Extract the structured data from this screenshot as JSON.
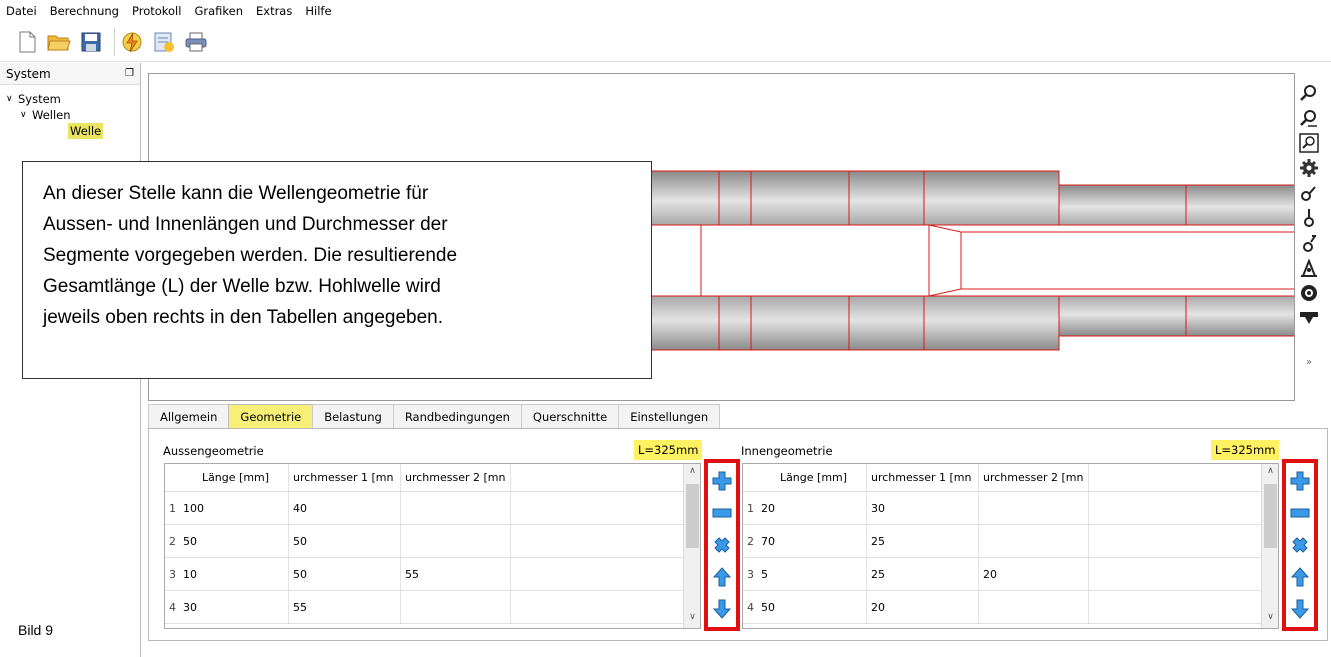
{
  "menu": [
    "Datei",
    "Berechnung",
    "Protokoll",
    "Grafiken",
    "Extras",
    "Hilfe"
  ],
  "system_panel": {
    "title": "System",
    "tree": {
      "root": "System",
      "group": "Wellen",
      "item": "Welle"
    }
  },
  "tooltip": {
    "lines": [
      "An dieser Stelle kann die Wellengeometrie für",
      "Aussen- und Innenlängen und Durchmesser der",
      "Segmente vorgegeben werden. Die resultierende",
      "Gesamtlänge (L) der Welle bzw. Hohlwelle wird",
      "jeweils oben rechts in den Tabellen angegeben."
    ]
  },
  "tabs": [
    "Allgemein",
    "Geometrie",
    "Belastung",
    "Randbedingungen",
    "Querschnitte",
    "Einstellungen"
  ],
  "active_tab": "Geometrie",
  "outer": {
    "label": "Aussengeometrie",
    "length_badge": "L=325mm",
    "headers": [
      "Länge [mm]",
      "urchmesser 1 [mn",
      "urchmesser 2 [mn"
    ],
    "rows": [
      {
        "n": "1",
        "a": "100",
        "b": "40",
        "c": ""
      },
      {
        "n": "2",
        "a": "50",
        "b": "50",
        "c": ""
      },
      {
        "n": "3",
        "a": "10",
        "b": "50",
        "c": "55"
      },
      {
        "n": "4",
        "a": "30",
        "b": "55",
        "c": ""
      }
    ]
  },
  "inner": {
    "label": "Innengeometrie",
    "length_badge": "L=325mm",
    "headers": [
      "Länge [mm]",
      "urchmesser 1 [mn",
      "urchmesser 2 [mn"
    ],
    "rows": [
      {
        "n": "1",
        "a": "20",
        "b": "30",
        "c": ""
      },
      {
        "n": "2",
        "a": "70",
        "b": "25",
        "c": ""
      },
      {
        "n": "3",
        "a": "5",
        "b": "25",
        "c": "20"
      },
      {
        "n": "4",
        "a": "50",
        "b": "20",
        "c": ""
      }
    ]
  },
  "caption": "Bild 9",
  "colors": {
    "accent_yellow": "#f7ef78",
    "highlight_red": "#e01010",
    "action_blue": "#2a8fe0",
    "shaft_stroke": "#d81818"
  }
}
